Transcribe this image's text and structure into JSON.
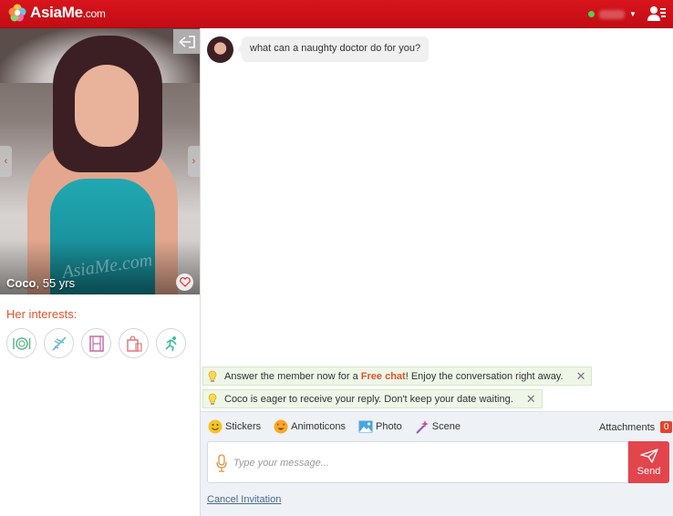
{
  "brand": {
    "name": "AsiaMe",
    "domain": ".com",
    "color": "#d0121a"
  },
  "header": {
    "status": "online",
    "status_color": "#4fd14f",
    "menu_icon": "profile-menu-icon"
  },
  "profile": {
    "name": "Coco",
    "age": ", 55 yrs",
    "watermark": "AsiaMe.com",
    "interests_title": "Her interests:",
    "interests": [
      "dining-icon",
      "travel-icon",
      "movies-icon",
      "shopping-icon",
      "sports-icon"
    ]
  },
  "chat": {
    "messages": [
      {
        "from": "Coco",
        "text": "what can a naughty doctor do for you?"
      }
    ],
    "tips": [
      {
        "before": "Answer the member now for a ",
        "highlight": "Free chat",
        "after": "! Enjoy the conversation right away."
      },
      {
        "text": "Coco is eager to receive your reply. Don't keep your date waiting."
      }
    ]
  },
  "composer": {
    "tools": [
      {
        "label": "Stickers",
        "icon": "smiley-icon"
      },
      {
        "label": "Animoticons",
        "icon": "heart-eyes-icon"
      },
      {
        "label": "Photo",
        "icon": "photo-icon"
      },
      {
        "label": "Scene",
        "icon": "magic-wand-icon"
      }
    ],
    "attachments_label": "Attachments",
    "attachments_count": "0",
    "placeholder": "Type your message...",
    "send_label": "Send",
    "cancel_label": "Cancel Invitation"
  }
}
